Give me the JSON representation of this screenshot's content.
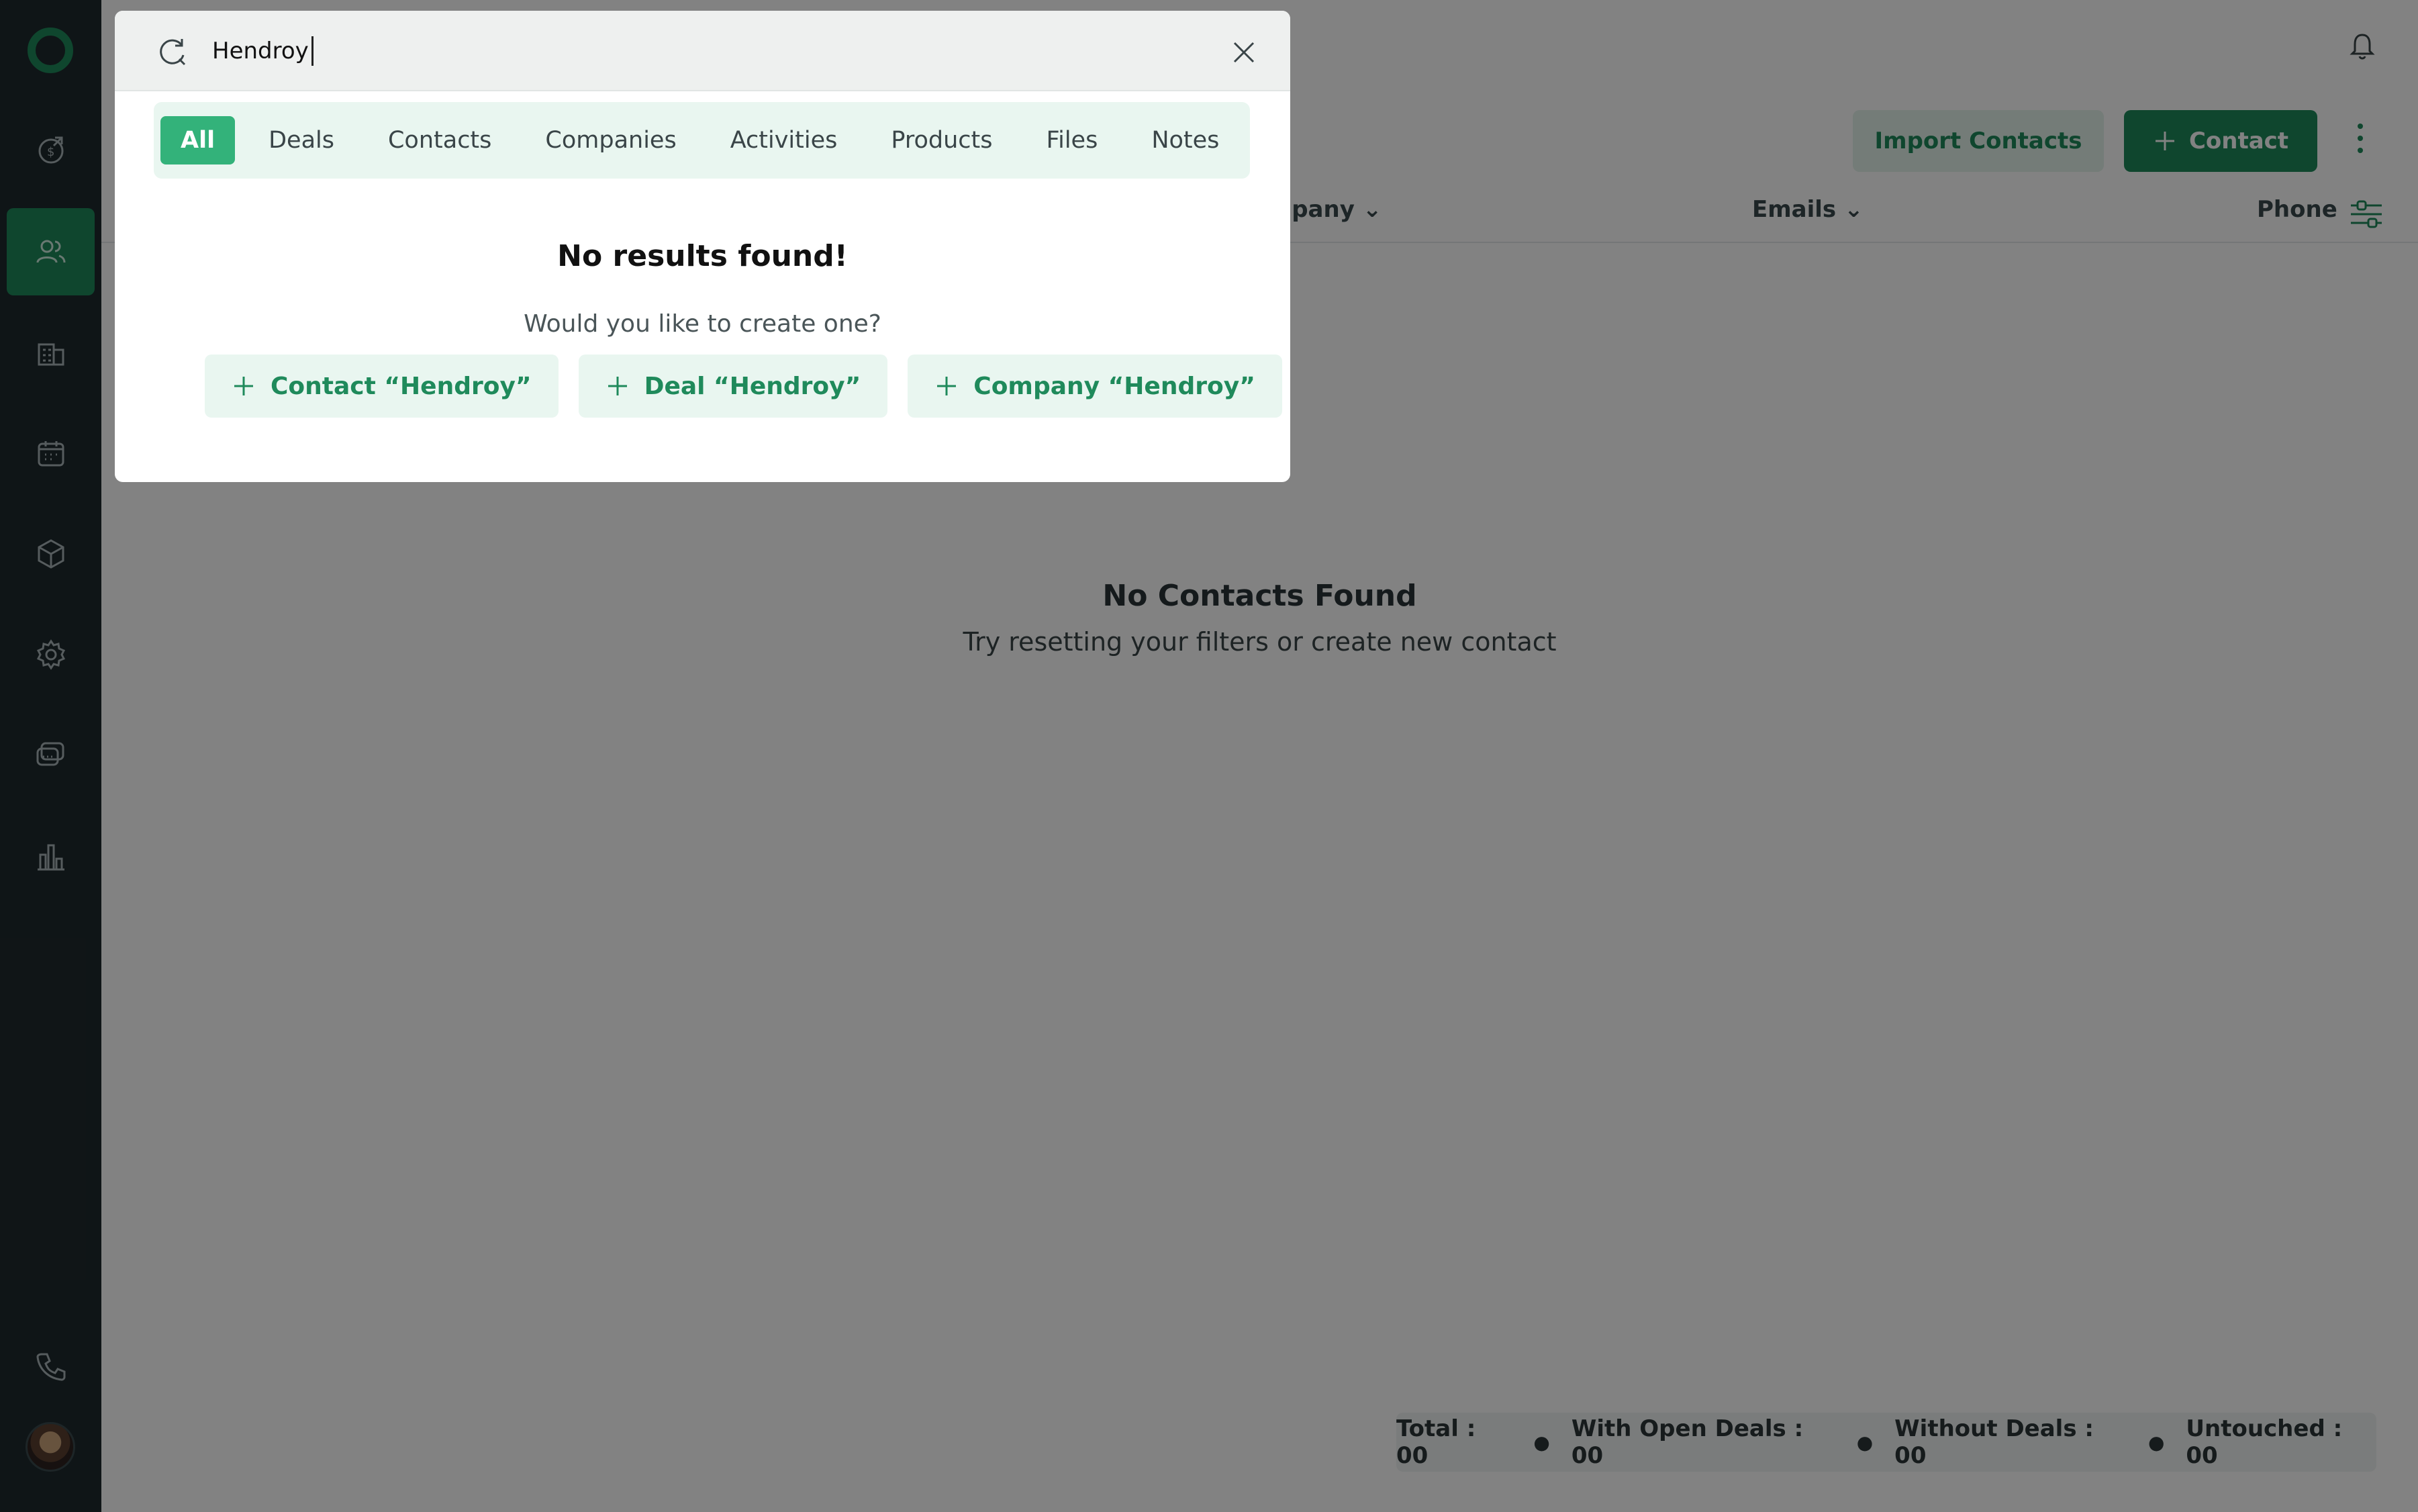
{
  "search": {
    "query": "Hendroy",
    "tabs": [
      "All",
      "Deals",
      "Contacts",
      "Companies",
      "Activities",
      "Products",
      "Files",
      "Notes"
    ],
    "active_tab": "All",
    "no_results_title": "No results found!",
    "create_question": "Would you like to create one?",
    "create_options": [
      "Contact “Hendroy”",
      "Deal “Hendroy”",
      "Company “Hendroy”"
    ]
  },
  "header": {
    "import_label": "Import Contacts",
    "add_contact_label": "Contact"
  },
  "table": {
    "columns": [
      "npany",
      "Emails",
      "Phone"
    ]
  },
  "empty_state": {
    "title": "No Contacts Found",
    "subtitle": "Try resetting your filters or create new contact"
  },
  "stats": {
    "total": "Total : 00",
    "with_open_deals": "With Open Deals : 00",
    "without_deals": "Without Deals : 00",
    "untouched": "Untouched : 00"
  },
  "sidebar": {
    "items": [
      "deals-icon",
      "contacts-icon",
      "companies-icon",
      "calendar-icon",
      "products-icon",
      "settings-icon",
      "chat-icon",
      "reports-icon",
      "phone-icon"
    ],
    "active": "contacts-icon"
  },
  "colors": {
    "accent": "#1f8a5b",
    "accent_light": "#33b27a",
    "sidebar_bg": "#1f2a2e",
    "overlay": "rgba(0,0,0,0.49)"
  }
}
